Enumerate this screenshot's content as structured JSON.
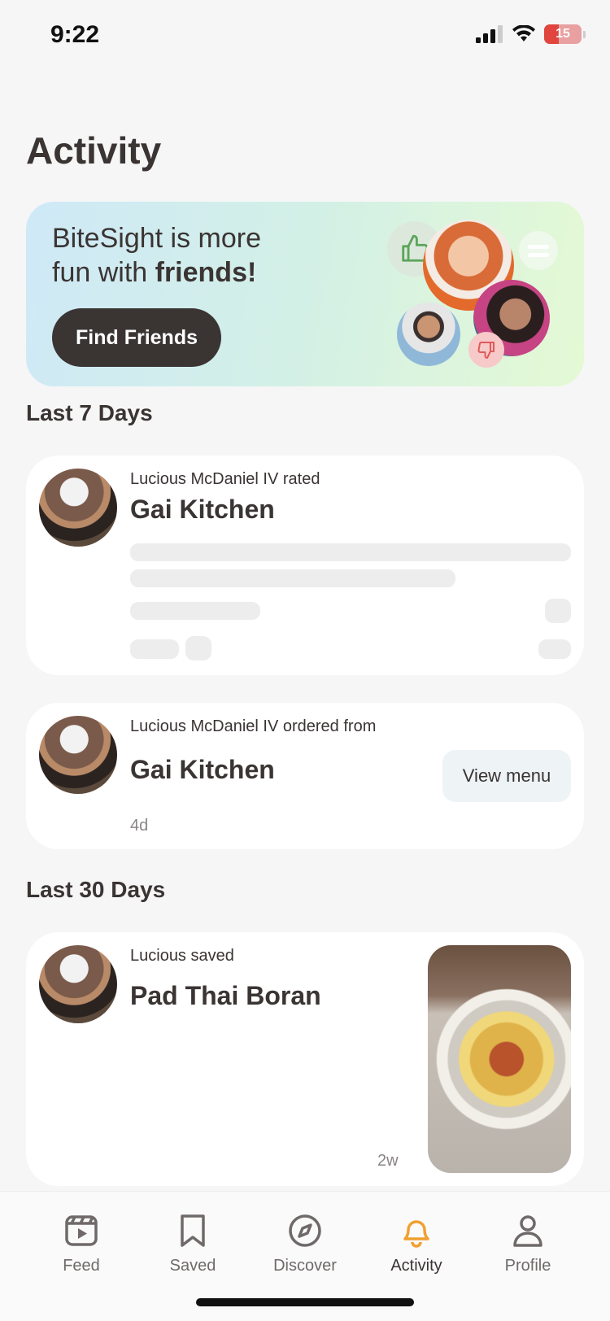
{
  "status": {
    "time": "9:22",
    "battery": "15"
  },
  "page": {
    "title": "Activity"
  },
  "promo": {
    "line1": "BiteSight is more",
    "line2_prefix": "fun with ",
    "line2_bold": "friends!",
    "button_label": "Find Friends"
  },
  "sections": {
    "last7": "Last 7 Days",
    "last30": "Last 30 Days"
  },
  "cards": [
    {
      "subtitle": "Lucious McDaniel IV rated",
      "title": "Gai Kitchen"
    },
    {
      "subtitle": "Lucious McDaniel IV ordered from",
      "title": "Gai Kitchen",
      "time": "4d",
      "button_label": "View menu"
    },
    {
      "subtitle": "Lucious saved",
      "title": "Pad Thai Boran",
      "time": "2w"
    }
  ],
  "tabs": [
    {
      "label": "Feed",
      "icon": "feed-icon"
    },
    {
      "label": "Saved",
      "icon": "bookmark-icon"
    },
    {
      "label": "Discover",
      "icon": "compass-icon"
    },
    {
      "label": "Activity",
      "icon": "bell-icon",
      "active": true
    },
    {
      "label": "Profile",
      "icon": "person-icon"
    }
  ],
  "colors": {
    "accent": "#f0a030",
    "text": "#3a3433",
    "like_green": "#5aa55a",
    "dislike_red": "#e05a5a"
  }
}
